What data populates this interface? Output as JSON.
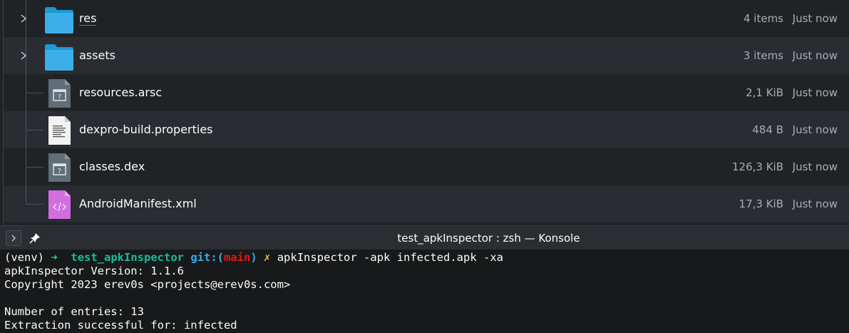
{
  "file_manager": {
    "rows": [
      {
        "name": "res",
        "size": "4 items",
        "modified": "Just now",
        "icon": "folder-icon",
        "expandable": true
      },
      {
        "name": "assets",
        "size": "3 items",
        "modified": "Just now",
        "icon": "folder-icon",
        "expandable": true
      },
      {
        "name": "resources.arsc",
        "size": "2,1 KiB",
        "modified": "Just now",
        "icon": "unknown-file-icon",
        "expandable": false
      },
      {
        "name": "dexpro-build.properties",
        "size": "484 B",
        "modified": "Just now",
        "icon": "text-file-icon",
        "expandable": false
      },
      {
        "name": "classes.dex",
        "size": "126,3 KiB",
        "modified": "Just now",
        "icon": "unknown-file-icon",
        "expandable": false
      },
      {
        "name": "AndroidManifest.xml",
        "size": "17,3 KiB",
        "modified": "Just now",
        "icon": "xml-file-icon",
        "expandable": false
      }
    ]
  },
  "konsole": {
    "title": "test_apkInspector : zsh — Konsole",
    "prompt": {
      "venv": "(venv)",
      "arrow": "➜",
      "dir": "test_apkInspector",
      "git_prefix": "git:(",
      "branch": "main",
      "git_suffix": ")",
      "dirty": "✗",
      "command": "apkInspector -apk infected.apk -xa"
    },
    "output_lines": [
      "apkInspector Version: 1.1.6",
      "Copyright 2023 erev0s <projects@erev0s.com>",
      "",
      "Number of entries: 13",
      "Extraction successful for: infected"
    ]
  },
  "colors": {
    "folder": "#3daee9",
    "xml_file": "#d26ee0",
    "prompt_green": "#1cdc9a",
    "branch_red": "#ed1515",
    "dirty_yellow": "#fdbc4b"
  }
}
